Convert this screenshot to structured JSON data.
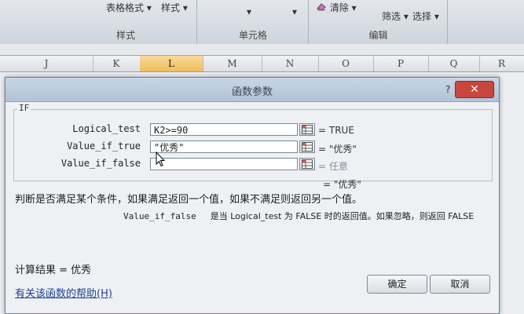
{
  "ribbon": {
    "items": [
      "表格格式",
      "样式",
      "清除",
      "筛选",
      "选择"
    ],
    "groups": [
      "样式",
      "单元格",
      "编辑"
    ]
  },
  "columns": [
    "J",
    "K",
    "L",
    "M",
    "N",
    "O",
    "P",
    "Q",
    "R"
  ],
  "selected_column": "L",
  "dialog": {
    "title": "函数参数",
    "help_glyph": "?",
    "close_glyph": "✕",
    "function_name": "IF",
    "args": [
      {
        "label": "Logical_test",
        "value": "K2>=90",
        "result": "= TRUE"
      },
      {
        "label": "Value_if_true",
        "value": "\"优秀\"",
        "result": "= \"优秀\""
      },
      {
        "label": "Value_if_false",
        "value": "",
        "result": "= 任意"
      }
    ],
    "overall_result": "= \"优秀\"",
    "description": "判断是否满足某个条件，如果满足返回一个值，如果不满足则返回另一个值。",
    "param_name": "Value_if_false",
    "param_description": "是当 Logical_test 为 FALSE 时的返回值。如果忽略，则返回 FALSE",
    "calc_result_label": "计算结果 =",
    "calc_result_value": "优秀",
    "help_link": "有关该函数的帮助(H)",
    "ok_label": "确定",
    "cancel_label": "取消"
  },
  "colors": {
    "title_bar": "#b2c3d8",
    "close": "#c9463d",
    "selected_column": "#f1bd5b",
    "link": "#1f3f99"
  },
  "icons": [
    "dropdown-arrow-icon",
    "eraser-icon",
    "cell-reference-icon",
    "close-icon",
    "mouse-cursor-icon"
  ]
}
